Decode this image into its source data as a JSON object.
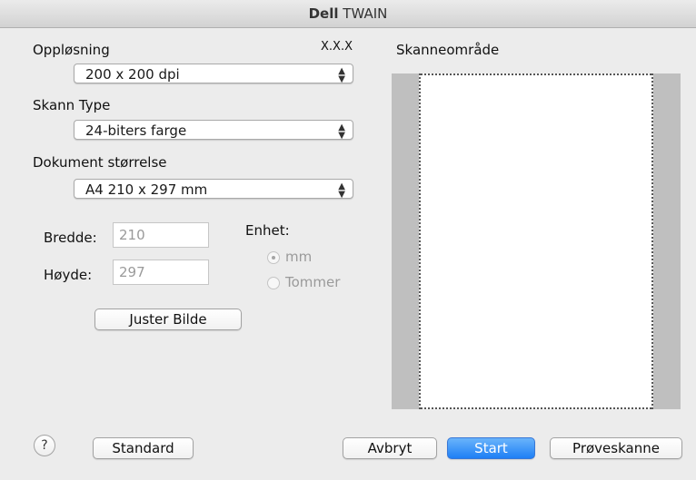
{
  "window": {
    "title_part1": "Dell",
    "title_part2": "TWAIN"
  },
  "version": "X.X.X",
  "resolution": {
    "label": "Oppløsning",
    "value": "200 x 200 dpi"
  },
  "scan_type": {
    "label": "Skann Type",
    "value": "24-biters farge"
  },
  "document_size": {
    "label": "Dokument størrelse",
    "value": "A4  210 x 297 mm"
  },
  "width": {
    "label": "Bredde:",
    "value": "210"
  },
  "height": {
    "label": "Høyde:",
    "value": "297"
  },
  "unit": {
    "label": "Enhet:",
    "options": [
      {
        "label": "mm",
        "selected": true
      },
      {
        "label": "Tommer",
        "selected": false
      }
    ]
  },
  "buttons": {
    "adjust_image": "Juster Bilde",
    "help": "?",
    "standard": "Standard",
    "cancel": "Avbryt",
    "start": "Start",
    "preview_scan": "Prøveskanne"
  },
  "scan_area": {
    "label": "Skanneområde"
  },
  "icons": {
    "popup_arrows": "up-down-chevron-icon",
    "help": "question-mark-icon"
  }
}
